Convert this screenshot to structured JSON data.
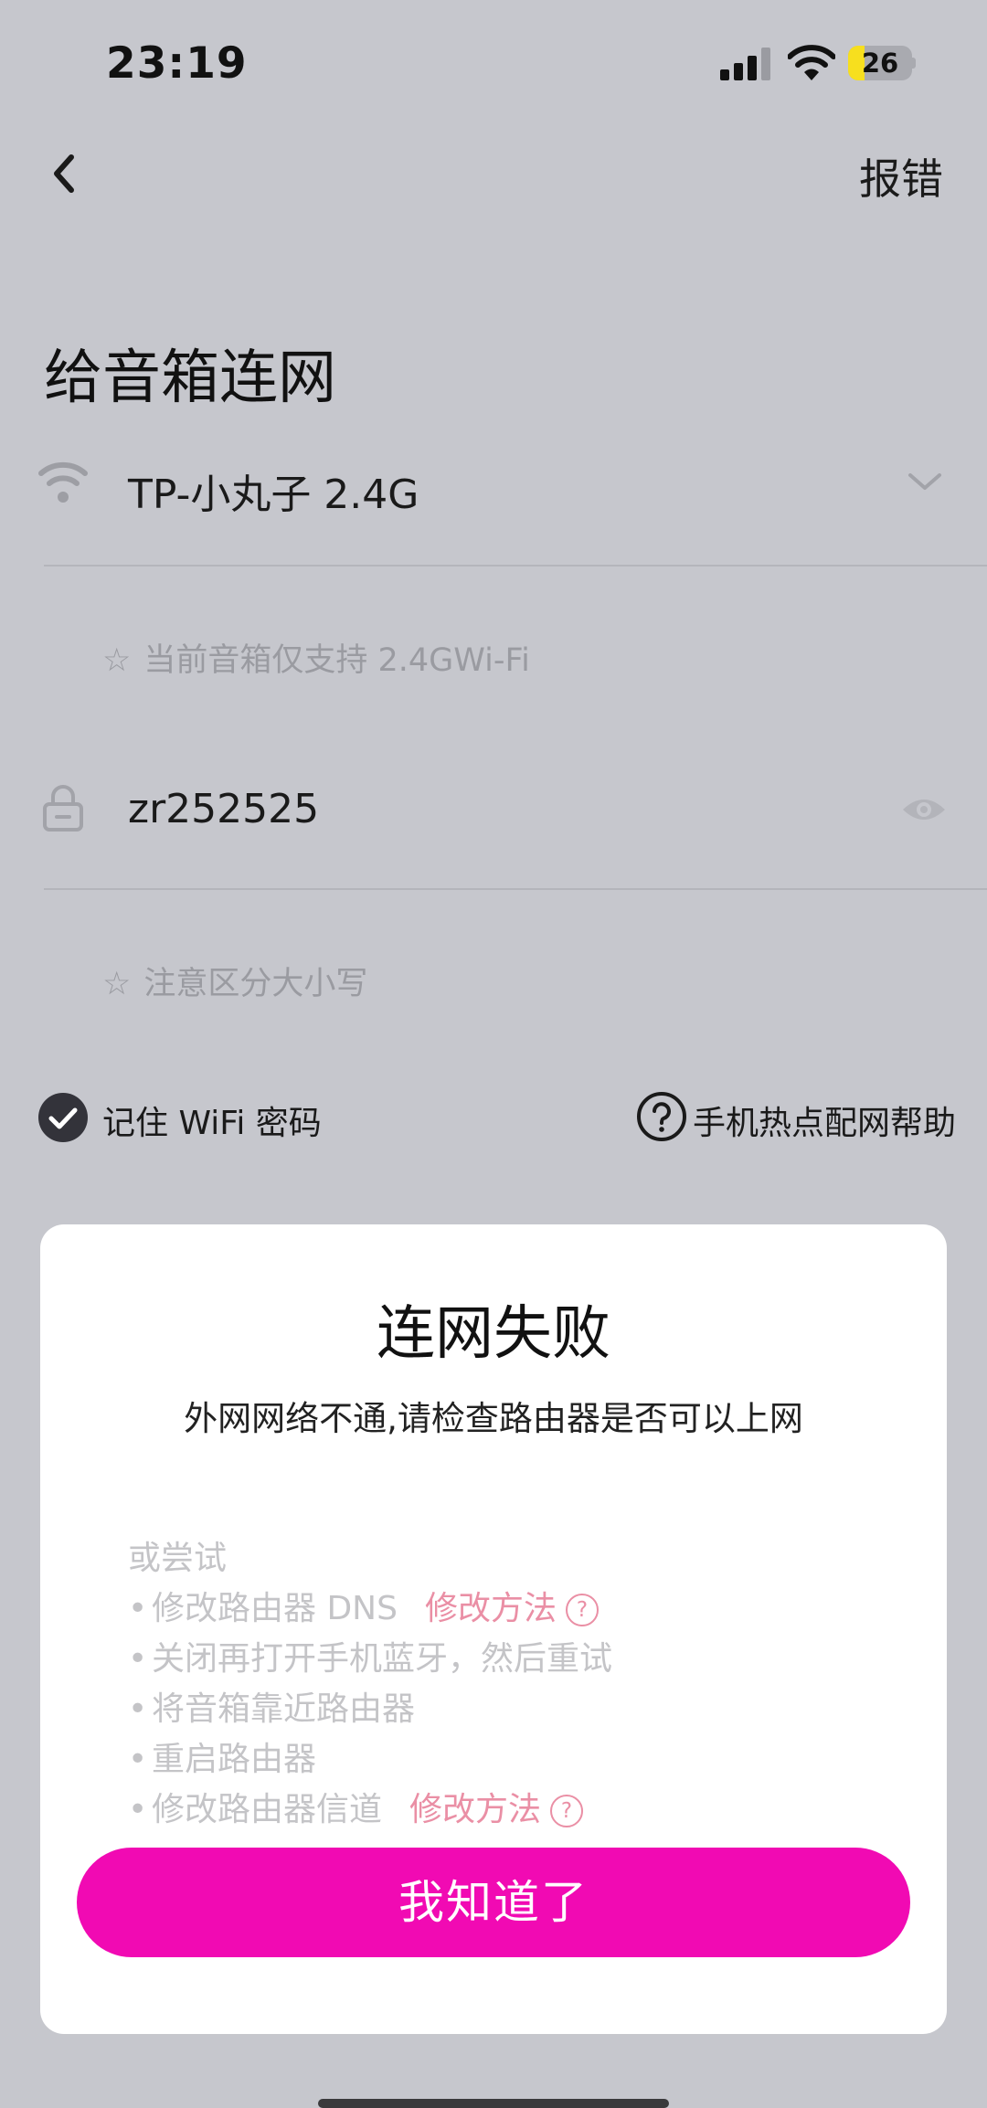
{
  "status_bar": {
    "time": "23:19",
    "battery": "26",
    "battery_level": 0.26
  },
  "nav": {
    "report_label": "报错"
  },
  "page": {
    "title": "给音箱连网",
    "wifi": {
      "ssid": "TP-小丸子 2.4G",
      "hint_star": "☆",
      "hint": "当前音箱仅支持 2.4GWi-Fi"
    },
    "password": {
      "value": "zr252525",
      "hint_star": "☆",
      "hint": "注意区分大小写"
    },
    "remember_label": "记住 WiFi 密码",
    "help_label": "手机热点配网帮助"
  },
  "dialog": {
    "title": "连网失败",
    "message": "外网网络不通,请检查路由器是否可以上网",
    "tips_heading": "或尝试",
    "bullet": "•",
    "help_q": "?",
    "tips": [
      {
        "text": "修改路由器 DNS",
        "link": "修改方法"
      },
      {
        "text": "关闭再打开手机蓝牙，然后重试"
      },
      {
        "text": "将音箱靠近路由器"
      },
      {
        "text": "重启路由器"
      },
      {
        "text": "修改路由器信道",
        "link": "修改方法"
      }
    ],
    "ok_label": "我知道了"
  },
  "colors": {
    "accent": "#f10ab3",
    "link": "#ea8fa5",
    "background": "#c6c7cd"
  }
}
